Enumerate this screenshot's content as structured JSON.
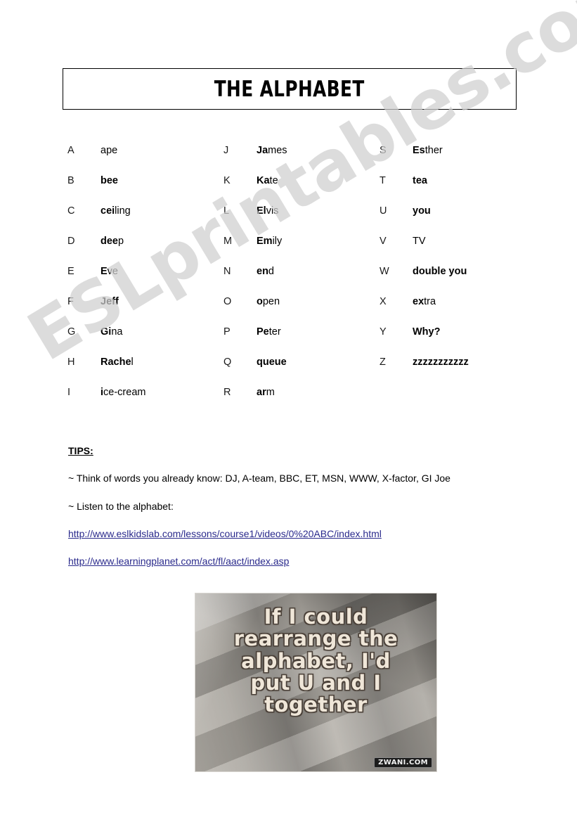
{
  "title": {
    "text": "THE ALPHABET"
  },
  "alphabet": {
    "columns": [
      {
        "rows": [
          {
            "letter": "A",
            "bold": "",
            "plain": "ape"
          },
          {
            "letter": "B",
            "bold": "bee",
            "plain": ""
          },
          {
            "letter": "C",
            "bold": "cei",
            "plain": "ling"
          },
          {
            "letter": "D",
            "bold": "dee",
            "plain": "p"
          },
          {
            "letter": "E",
            "bold": "E",
            "plain": "ve"
          },
          {
            "letter": "F",
            "bold": "Jeff",
            "plain": ""
          },
          {
            "letter": "G",
            "bold": "Gi",
            "plain": "na"
          },
          {
            "letter": "H",
            "bold": "Rache",
            "plain": "l"
          },
          {
            "letter": "I",
            "bold": "i",
            "plain": "ce-cream"
          }
        ]
      },
      {
        "rows": [
          {
            "letter": "J",
            "bold": "Ja",
            "plain": "mes"
          },
          {
            "letter": "K",
            "bold": "Ka",
            "plain": "te"
          },
          {
            "letter": "L",
            "bold": "El",
            "plain": "vis"
          },
          {
            "letter": "M",
            "bold": "Em",
            "plain": "ily"
          },
          {
            "letter": "N",
            "bold": "en",
            "plain": "d"
          },
          {
            "letter": "O",
            "bold": "o",
            "plain": "pen"
          },
          {
            "letter": "P",
            "bold": "Pe",
            "plain": "ter"
          },
          {
            "letter": "Q",
            "bold": "queue",
            "plain": ""
          },
          {
            "letter": "R",
            "bold": "ar",
            "plain": "m"
          }
        ]
      },
      {
        "rows": [
          {
            "letter": "S",
            "bold": "Es",
            "plain": "ther"
          },
          {
            "letter": "T",
            "bold": "tea",
            "plain": ""
          },
          {
            "letter": "U",
            "bold": "you",
            "plain": ""
          },
          {
            "letter": "V",
            "bold": "",
            "plain": "TV"
          },
          {
            "letter": "W",
            "bold": "double you",
            "plain": ""
          },
          {
            "letter": "X",
            "bold": "ex",
            "plain": "tra"
          },
          {
            "letter": "Y",
            "bold": "Why?",
            "plain": ""
          },
          {
            "letter": "Z",
            "bold": "zzzzzzzzzzz",
            "plain": ""
          }
        ]
      }
    ]
  },
  "tips": {
    "heading": "TIPS:",
    "line1": "~ Think of words you already know: DJ, A-team, BBC, ET, MSN, WWW, X-factor, GI Joe",
    "line2": "~ Listen to the alphabet:",
    "link1": "http://www.eslkidslab.com/lessons/course1/videos/0%20ABC/index.html",
    "link2": "http://www.learningplanet.com/act/fl/aact/index.asp"
  },
  "photo": {
    "caption_lines": [
      "If I could",
      "rearrange the",
      "alphabet, I'd",
      "put U and I",
      "together"
    ],
    "credit": "ZWANI.COM"
  },
  "watermark": {
    "text": "ESLprintables.com",
    "color": "#cfcfcf"
  },
  "colors": {
    "link": "#2a2a8c",
    "text": "#000000",
    "border": "#000000"
  }
}
